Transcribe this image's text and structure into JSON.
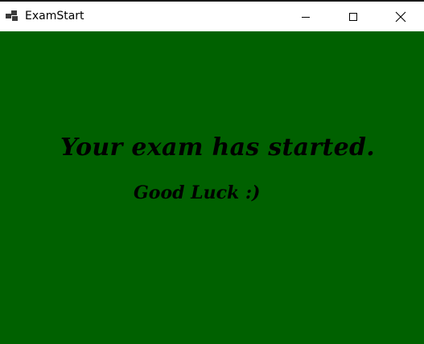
{
  "window": {
    "title": "ExamStart",
    "background_color": "#006100",
    "controls": {
      "minimize_icon": "minimize-icon",
      "maximize_icon": "maximize-icon",
      "close_icon": "close-icon"
    }
  },
  "content": {
    "headline": "Your exam has started.",
    "subline": "Good Luck :)"
  }
}
